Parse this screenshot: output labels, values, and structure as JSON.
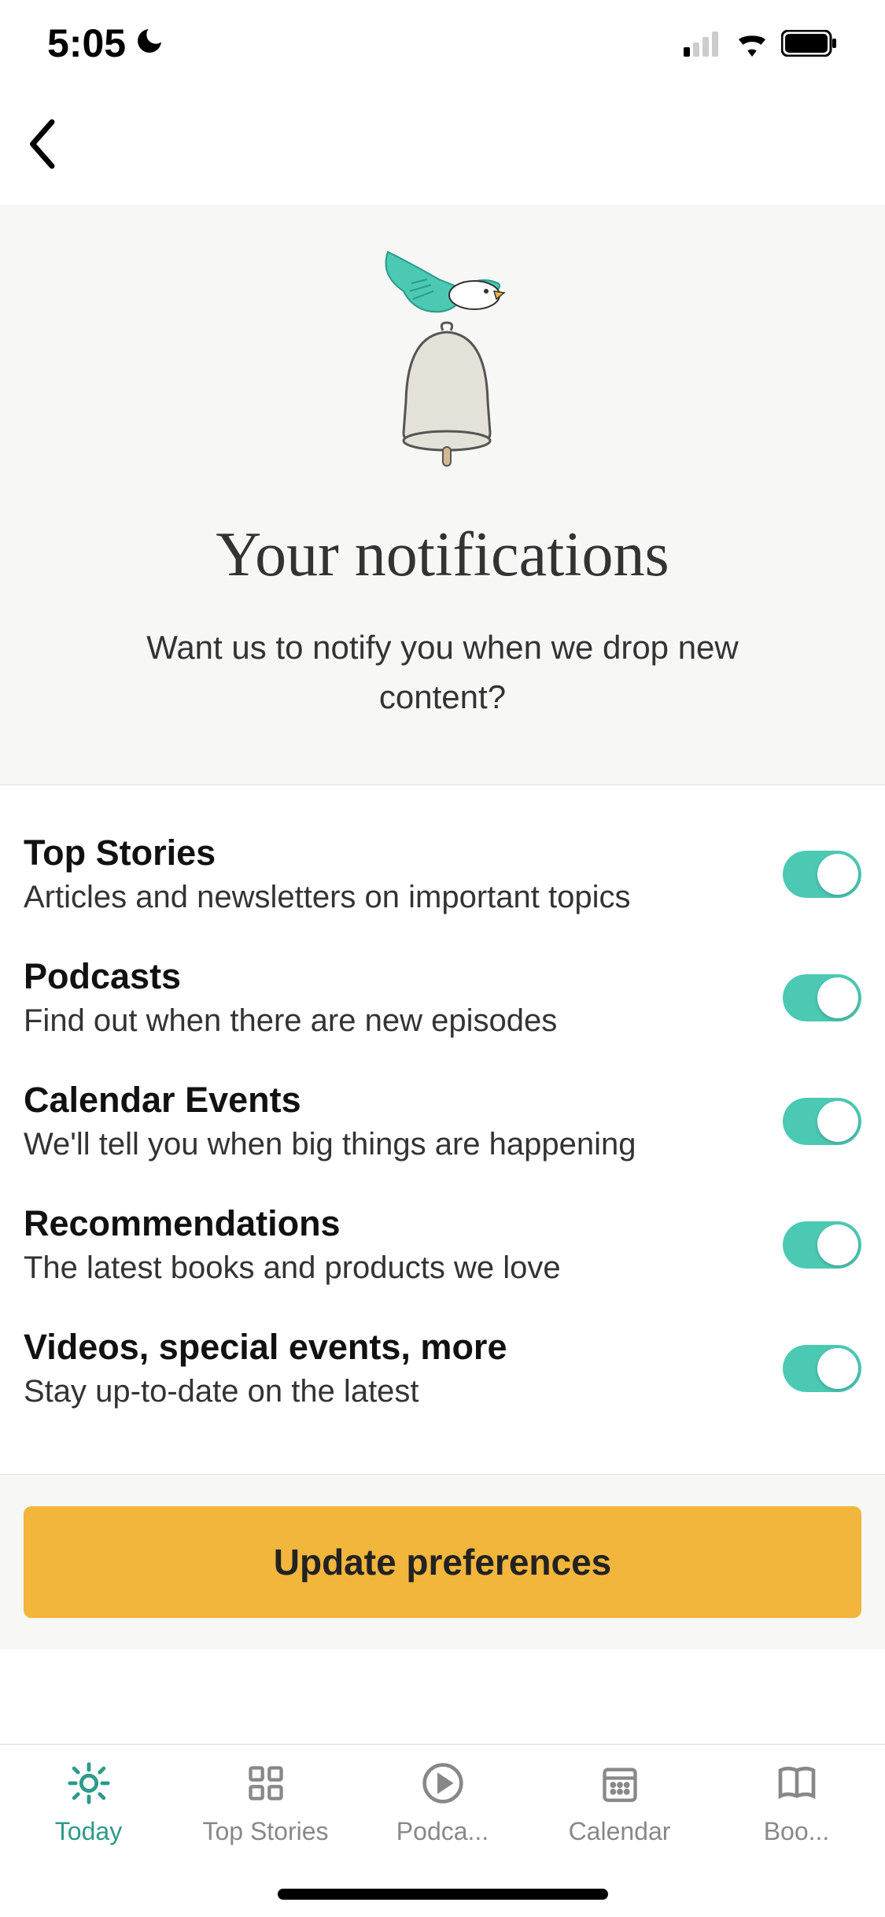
{
  "status": {
    "time": "5:05",
    "dnd": true
  },
  "hero": {
    "title": "Your notifications",
    "subtitle": "Want us to notify you when we drop new content?"
  },
  "settings": [
    {
      "title": "Top Stories",
      "desc": "Articles and newsletters on important topics",
      "on": true
    },
    {
      "title": "Podcasts",
      "desc": "Find out when there are new episodes",
      "on": true
    },
    {
      "title": "Calendar Events",
      "desc": "We'll tell you when big things are happening",
      "on": true
    },
    {
      "title": "Recommendations",
      "desc": "The latest books and products we love",
      "on": true
    },
    {
      "title": "Videos, special events, more",
      "desc": "Stay up-to-date on the latest",
      "on": true
    }
  ],
  "cta": {
    "label": "Update preferences"
  },
  "tabs": [
    {
      "label": "Today",
      "icon": "sun",
      "active": true
    },
    {
      "label": "Top Stories",
      "icon": "grid",
      "active": false
    },
    {
      "label": "Podca...",
      "icon": "play",
      "active": false
    },
    {
      "label": "Calendar",
      "icon": "calendar",
      "active": false
    },
    {
      "label": "Boo...",
      "icon": "book",
      "active": false
    }
  ]
}
